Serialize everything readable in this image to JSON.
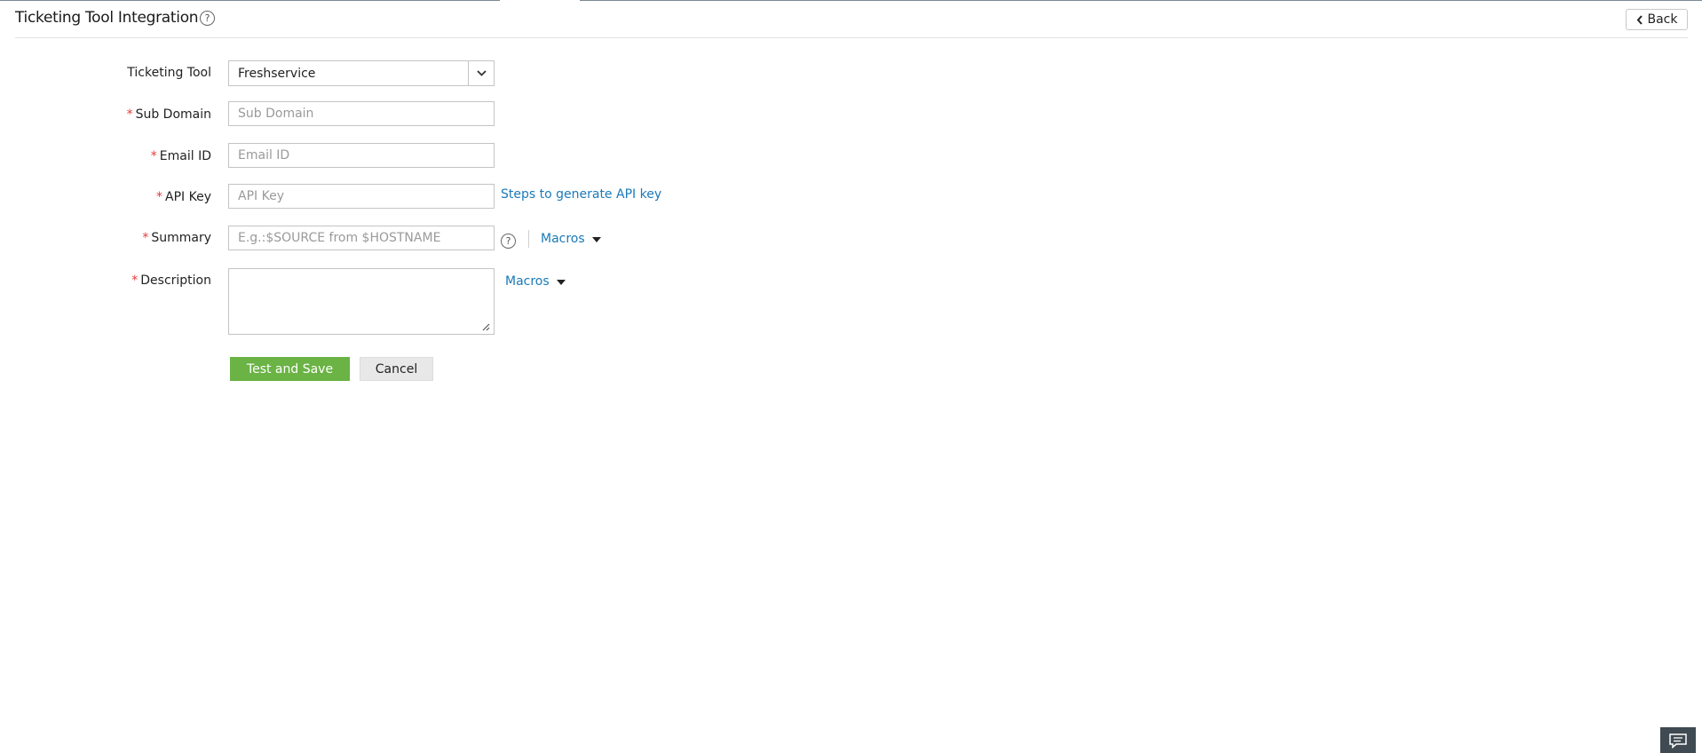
{
  "header": {
    "title": "Ticketing Tool Integration",
    "help_glyph": "?",
    "back_label": "Back"
  },
  "form": {
    "ticketing_tool": {
      "label": "Ticketing Tool",
      "value": "Freshservice"
    },
    "sub_domain": {
      "label": "Sub Domain",
      "placeholder": "Sub Domain",
      "required": true
    },
    "email_id": {
      "label": "Email ID",
      "placeholder": "Email ID",
      "required": true
    },
    "api_key": {
      "label": "API Key",
      "placeholder": "API Key",
      "required": true,
      "help_link": "Steps to generate API key"
    },
    "summary": {
      "label": "Summary",
      "placeholder": "E.g.:$SOURCE from $HOSTNAME",
      "required": true,
      "macros_label": "Macros",
      "help_glyph": "?"
    },
    "description": {
      "label": "Description",
      "value": "",
      "required": true,
      "macros_label": "Macros"
    },
    "required_marker": "*"
  },
  "actions": {
    "primary_label": "Test and Save",
    "secondary_label": "Cancel"
  },
  "icons": {
    "help": "help-circle-icon",
    "back": "chevron-left-icon",
    "dropdown": "chevron-down-icon",
    "macros": "caret-down-icon",
    "chat": "chat-bubble-icon"
  },
  "colors": {
    "primary_button": "#6ab344",
    "link": "#1a7ab8",
    "required": "#e53935",
    "chat_button": "#3f4a52"
  }
}
